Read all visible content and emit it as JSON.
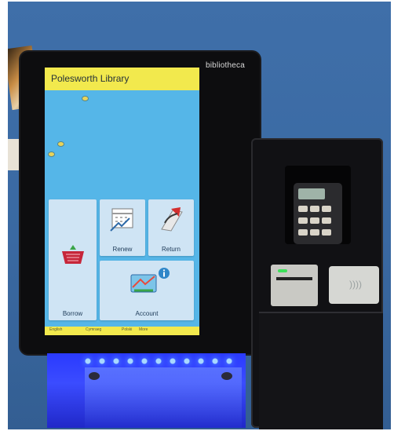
{
  "kiosk": {
    "brand": "bibliotheca"
  },
  "screen": {
    "title": "Polesworth Library",
    "tiles": {
      "renew_label": "Renew",
      "return_label": "Return",
      "borrow_label": "Borrow",
      "account_label": "Account"
    },
    "bottom_bar": [
      "English",
      "Cymraeg",
      "Polski",
      "More"
    ]
  },
  "colors": {
    "screen_background": "#55b6e8",
    "header_yellow": "#f2e94d",
    "base_glow": "#3b4cff",
    "card_led": "#3de05a"
  },
  "icons": [
    "basket-icon",
    "calendar-icon",
    "return-icon",
    "account-card-icon",
    "info-icon"
  ]
}
